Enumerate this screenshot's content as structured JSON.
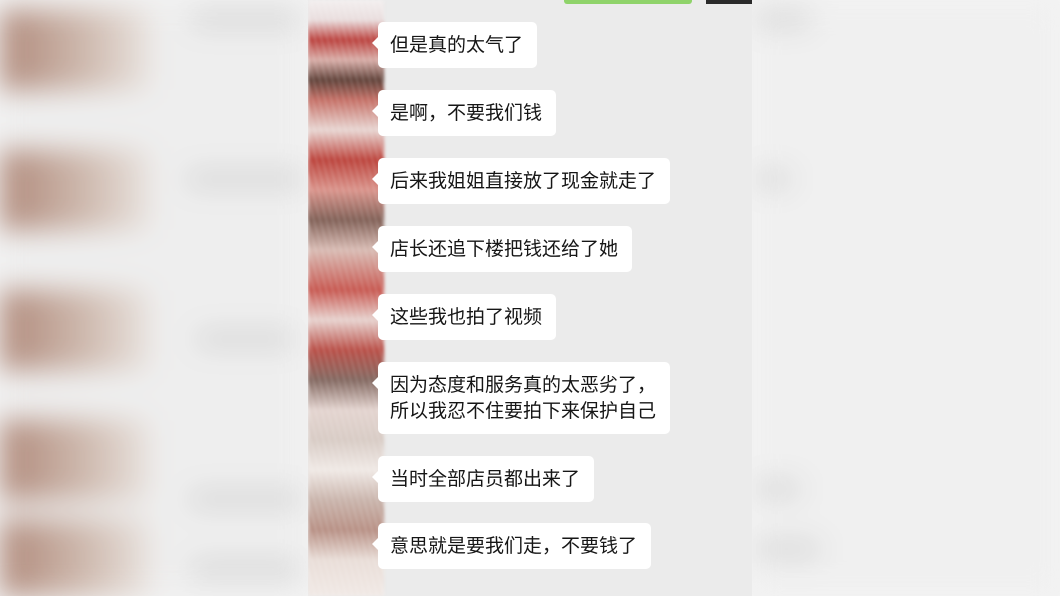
{
  "chat": {
    "messages": [
      {
        "lines": [
          "但是真的太气了"
        ]
      },
      {
        "lines": [
          "是啊，不要我们钱"
        ]
      },
      {
        "lines": [
          "后来我姐姐直接放了现金就走了"
        ]
      },
      {
        "lines": [
          "店长还追下楼把钱还给了她"
        ]
      },
      {
        "lines": [
          "这些我也拍了视频"
        ]
      },
      {
        "lines": [
          "因为态度和服务真的太恶劣了，",
          "所以我忍不住要拍下来保护自己"
        ]
      },
      {
        "lines": [
          "当时全部店员都出来了"
        ]
      },
      {
        "lines": [
          "意思就是要我们走，不要钱了"
        ]
      }
    ]
  },
  "colors": {
    "chat_background": "#ebebeb",
    "bubble_background": "#ffffff",
    "text": "#161616",
    "top_indicator_green": "#8fd36a"
  }
}
